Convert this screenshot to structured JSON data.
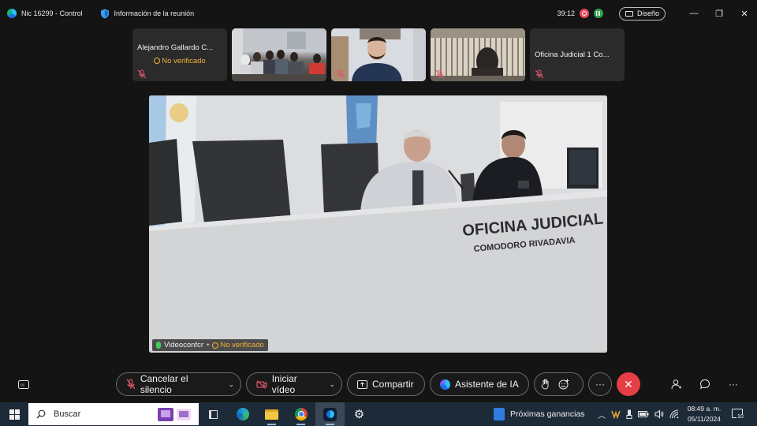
{
  "titlebar": {
    "app_title": "Nic 16299 - Control",
    "meeting_info": "Información de la reunión",
    "timer": "39:12",
    "layout_label": "Diseño",
    "minimize": "—",
    "restore": "❐",
    "close": "✕"
  },
  "thumbnails": [
    {
      "name": "Alejandro Gallardo C...",
      "status": "No verificado",
      "type": "no-video",
      "muted": true
    },
    {
      "name": "",
      "type": "video-classroom",
      "muted": false
    },
    {
      "name": "",
      "type": "video-person",
      "muted": true
    },
    {
      "name": "",
      "type": "video-blinds",
      "muted": true
    },
    {
      "name": "Oficina Judicial 1 Co...",
      "type": "no-video",
      "muted": true
    }
  ],
  "main_video": {
    "participant": "Videoconfcr",
    "separator": "•",
    "status": "No verificado",
    "desk_sign_line1": "OFICINA JUDICIAL",
    "desk_sign_line2": "COMODORO RIVADAVIA"
  },
  "controls": {
    "unmute_label": "Cancelar el silencio",
    "start_video_label": "Iniciar vídeo",
    "share_label": "Compartir",
    "ai_assistant_label": "Asistente de IA",
    "more_label": "···",
    "end_label": "✕",
    "right_more_label": "···"
  },
  "taskbar": {
    "search_label": "Buscar",
    "news_label": "Próximas ganancias",
    "time": "08:49 a. m.",
    "date": "05/11/2024",
    "notification_count": "10"
  },
  "colors": {
    "warning": "#f0b236",
    "end_call": "#e53e46",
    "mic_active": "#3ccf5b",
    "taskbar_bg": "#1d2a38"
  }
}
